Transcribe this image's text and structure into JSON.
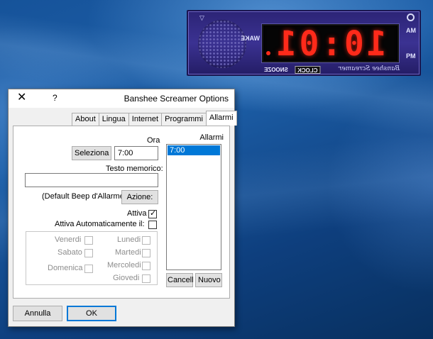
{
  "colors": {
    "desktop": "#1a5aa3",
    "clock_body": "#332a85",
    "lcd_digits": "#ff2a1a",
    "selection": "#0078d7"
  },
  "clock": {
    "time": "10:01",
    "am": "AM",
    "pm": "PM",
    "wake": "WAKE",
    "snooze": "SNOOZE",
    "clock": "CLOCK",
    "signature": "Banshee Screamer",
    "icons": [
      "speaker-grille-icon",
      "power-icon",
      "triangle-menu-icon"
    ]
  },
  "dialog": {
    "title": "Banshee Screamer Options",
    "help": "?",
    "close": "✕",
    "tabs": [
      "Allarmi",
      "Programmi",
      "Internet",
      "Lingua",
      "About"
    ],
    "active_tab": "Allarmi",
    "alarms_label": "Allarmi",
    "alarms": [
      "7:00"
    ],
    "new_button": "Nuovo",
    "delete_button": "Cancell",
    "time_label": "Ora",
    "time_value": "7:00",
    "select_button": "Seleziona",
    "memo_label": "Testo memorico:",
    "memo_value": "",
    "action_button": "Azione:",
    "action_value": "(Default Beep d'Allarme)",
    "active_label": "Attiva",
    "active_checked": true,
    "auto_label": "Attiva Automaticamente il:",
    "auto_checked": false,
    "days_left": [
      "Lunedi",
      "Martedi",
      "Mercoledi",
      "Giovedi"
    ],
    "days_right": [
      "Venerdi",
      "Sabato",
      "Domenica"
    ],
    "ok_button": "OK",
    "cancel_button": "Annulla"
  }
}
